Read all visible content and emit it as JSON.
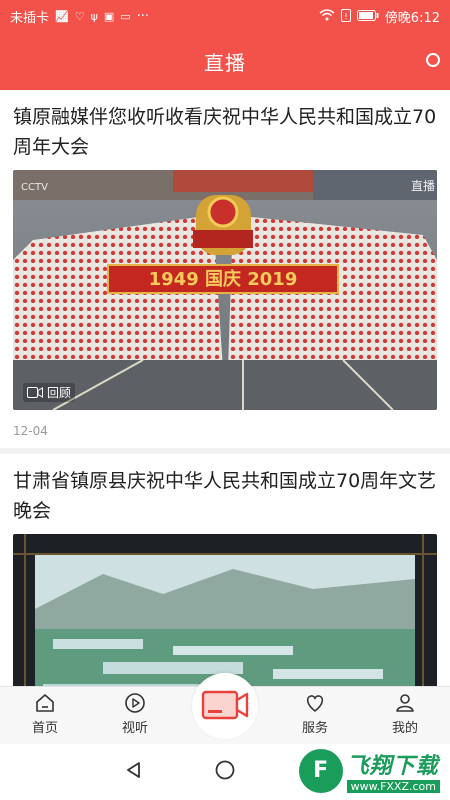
{
  "status_bar": {
    "carrier": "未插卡",
    "time_label": "傍晚6:12",
    "more": "···"
  },
  "header": {
    "title": "直播"
  },
  "feed": [
    {
      "title": "镇原融媒伴您收听收看庆祝中华人民共和国成立70周年大会",
      "badge": "回顾",
      "date": "12-04",
      "image_text": "1949 国庆 2019",
      "overlay_right": "直播",
      "overlay_left": "CCTV"
    },
    {
      "title": "甘肃省镇原县庆祝中华人民共和国成立70周年文艺晚会"
    }
  ],
  "tabbar": {
    "items": [
      {
        "label": "首页",
        "icon": "home-icon"
      },
      {
        "label": "视听",
        "icon": "play-icon"
      },
      {
        "label": "",
        "icon": "video-camera-icon"
      },
      {
        "label": "服务",
        "icon": "heart-icon"
      },
      {
        "label": "我的",
        "icon": "user-icon"
      }
    ]
  },
  "watermark": {
    "name": "飞翔下载",
    "url": "www.FXXZ.com"
  },
  "colors": {
    "brand": "#f2524a",
    "watermark": "#1a9d5a"
  }
}
